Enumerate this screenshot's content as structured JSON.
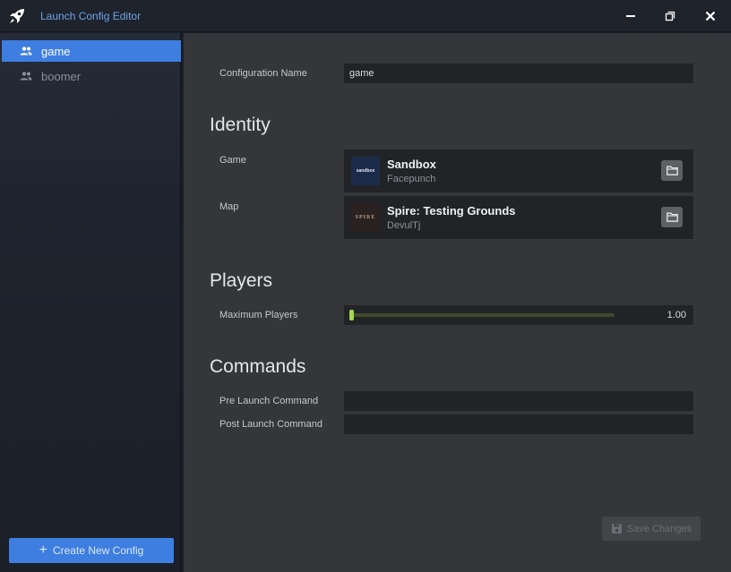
{
  "window": {
    "title": "Launch Config Editor",
    "minimize_icon": "minimize-icon",
    "restore_icon": "restore-icon",
    "close_icon": "close-icon"
  },
  "sidebar": {
    "items": [
      {
        "label": "game",
        "icon": "users-icon",
        "active": true
      },
      {
        "label": "boomer",
        "icon": "users-icon",
        "active": false
      }
    ],
    "create_label": "Create New Config"
  },
  "config": {
    "name_label": "Configuration Name",
    "name_value": "game"
  },
  "identity": {
    "title": "Identity",
    "game_label": "Game",
    "game": {
      "name": "Sandbox",
      "org": "Facepunch",
      "thumb_text": "sandbox"
    },
    "map_label": "Map",
    "map": {
      "name": "Spire: Testing Grounds",
      "org": "DevulTj",
      "thumb_text": "SPIRE"
    }
  },
  "players": {
    "title": "Players",
    "max_label": "Maximum Players",
    "max_value": "1.00",
    "slider_fraction": 0.0
  },
  "commands": {
    "title": "Commands",
    "pre_label": "Pre Launch Command",
    "pre_value": "",
    "post_label": "Post Launch Command",
    "post_value": ""
  },
  "footer": {
    "save_label": "Save Changes"
  },
  "colors": {
    "accent": "#3d7ee0",
    "slider": "#8fc53a",
    "panel": "#343639",
    "input": "#222326"
  }
}
